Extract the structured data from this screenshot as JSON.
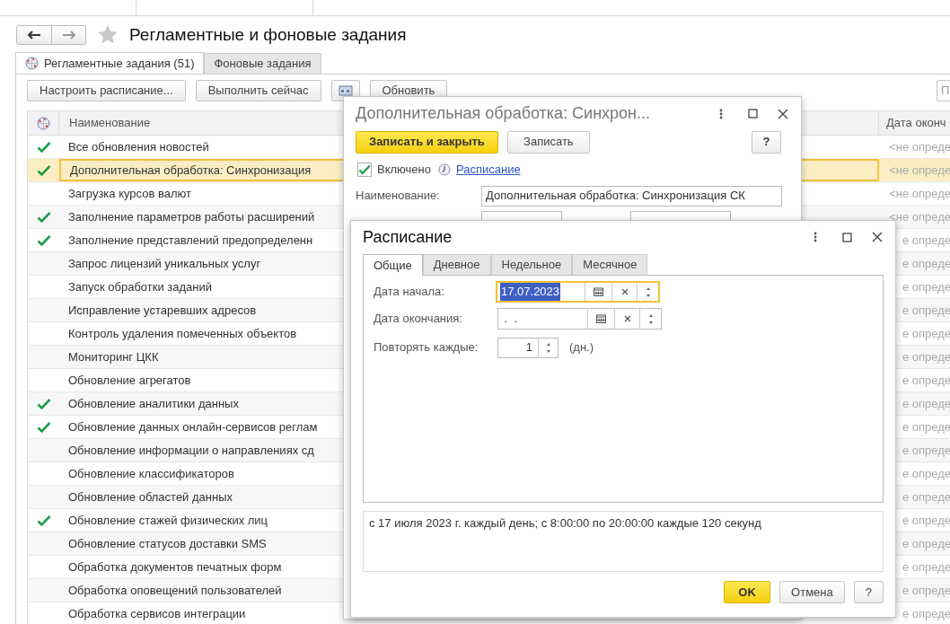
{
  "title": "Регламентные и фоновые задания",
  "tabs": [
    {
      "label": "Регламентные задания (51)",
      "selected": true,
      "kind": "icon"
    },
    {
      "label": "Фоновые задания",
      "selected": false,
      "kind": "plain"
    }
  ],
  "toolbar": [
    {
      "kind": "text",
      "label": "Настроить расписание..."
    },
    {
      "kind": "text",
      "label": "Выполнить сейчас"
    },
    {
      "kind": "icon"
    },
    {
      "kind": "text",
      "label": "Обновить"
    }
  ],
  "search": {
    "placeholder": "П"
  },
  "table": {
    "columns": [
      "Наименование",
      "Дата оконч"
    ],
    "rows": [
      {
        "name": "Все обновления новостей",
        "enabled": true,
        "selected": false,
        "end_date": "<не опреде"
      },
      {
        "name": "Дополнительная обработка: Синхронизация",
        "enabled": true,
        "selected": true,
        "end_date": "<не опреде"
      },
      {
        "name": "Загрузка курсов валют",
        "enabled": false,
        "selected": false,
        "end_date": "<не опреде"
      },
      {
        "name": "Заполнение параметров работы расширений",
        "enabled": true,
        "selected": false,
        "end_date": "<не опреде"
      },
      {
        "name": "Заполнение представлений предопределенн",
        "enabled": true,
        "selected": false,
        "end_date": "е опреде"
      },
      {
        "name": "Запрос лицензий уникальных услуг",
        "enabled": false,
        "selected": false,
        "end_date": "е опреде"
      },
      {
        "name": "Запуск обработки заданий",
        "enabled": false,
        "selected": false,
        "end_date": "е опреде"
      },
      {
        "name": "Исправление устаревших адресов",
        "enabled": false,
        "selected": false,
        "end_date": "е опреде"
      },
      {
        "name": "Контроль удаления помеченных объектов",
        "enabled": false,
        "selected": false,
        "end_date": "е опреде"
      },
      {
        "name": "Мониторинг ЦКК",
        "enabled": false,
        "selected": false,
        "end_date": "е опреде"
      },
      {
        "name": "Обновление агрегатов",
        "enabled": false,
        "selected": false,
        "end_date": "е опреде"
      },
      {
        "name": "Обновление аналитики данных",
        "enabled": true,
        "selected": false,
        "end_date": "е опреде"
      },
      {
        "name": "Обновление данных онлайн-сервисов реглам",
        "enabled": true,
        "selected": false,
        "end_date": "е опреде"
      },
      {
        "name": "Обновление информации о направлениях сд",
        "enabled": false,
        "selected": false,
        "end_date": "е опреде"
      },
      {
        "name": "Обновление классификаторов",
        "enabled": false,
        "selected": false,
        "end_date": "е опреде"
      },
      {
        "name": "Обновление областей данных",
        "enabled": false,
        "selected": false,
        "end_date": "е опреде"
      },
      {
        "name": "Обновление стажей физических лиц",
        "enabled": true,
        "selected": false,
        "end_date": "е опреде"
      },
      {
        "name": "Обновление статусов доставки SMS",
        "enabled": false,
        "selected": false,
        "end_date": "е опреде"
      },
      {
        "name": "Обработка документов печатных форм",
        "enabled": false,
        "selected": false,
        "end_date": "е опреде"
      },
      {
        "name": "Обработка оповещений пользователей",
        "enabled": false,
        "selected": false,
        "end_date": "е опреде"
      },
      {
        "name": "Обработка сервисов интеграции",
        "enabled": false,
        "selected": false,
        "end_date": "е опреде"
      }
    ]
  },
  "job_dialog": {
    "title": "Дополнительная обработка: Синхрон...",
    "buttons": [
      {
        "label": "Записать и закрыть",
        "kind": "primary"
      },
      {
        "label": "Записать",
        "kind": "plain"
      }
    ],
    "help": "?",
    "enabled": {
      "label": "Включено",
      "checked": true
    },
    "schedule_link": "Расписание",
    "name_label": "Наименование:",
    "name_value": "Дополнительная обработка: Синхронизация СК"
  },
  "schedule_dialog": {
    "title": "Расписание",
    "tabs": [
      {
        "label": "Общие",
        "selected": true
      },
      {
        "label": "Дневное",
        "selected": false
      },
      {
        "label": "Недельное",
        "selected": false
      },
      {
        "label": "Месячное",
        "selected": false
      }
    ],
    "fields": [
      {
        "label": "Дата начала:",
        "value": "17.07.2023",
        "focused": true
      },
      {
        "label": "Дата окончания:",
        "value": " .  .",
        "focused": false
      }
    ],
    "repeat": {
      "label": "Повторять каждые:",
      "value": "1",
      "unit": "(дн.)"
    },
    "summary": "с 17 июля 2023 г. каждый день; с 8:00:00 по 20:00:00 каждые 120 секунд",
    "buttons": [
      {
        "label": "OK",
        "kind": "primary"
      },
      {
        "label": "Отмена",
        "kind": "plain"
      },
      {
        "label": "?",
        "kind": "plain"
      }
    ]
  }
}
